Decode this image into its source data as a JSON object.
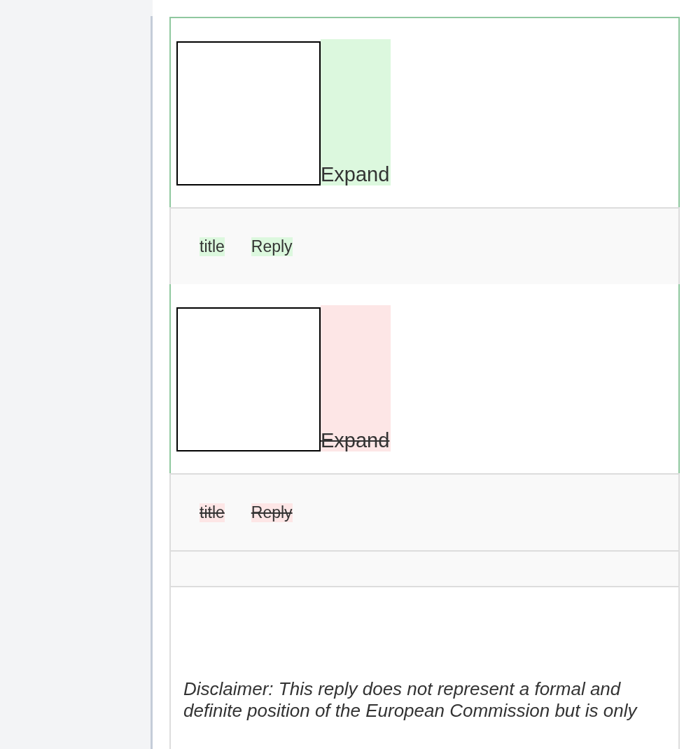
{
  "blocks": [
    {
      "kind": "added",
      "expand_label": "Expand",
      "actions": [
        "title",
        "Reply"
      ]
    },
    {
      "kind": "removed",
      "expand_label": "Expand",
      "actions": [
        "title",
        "Reply"
      ]
    }
  ],
  "disclaimer": "Disclaimer: This reply does not represent a formal and definite position of the European Commission but is only"
}
